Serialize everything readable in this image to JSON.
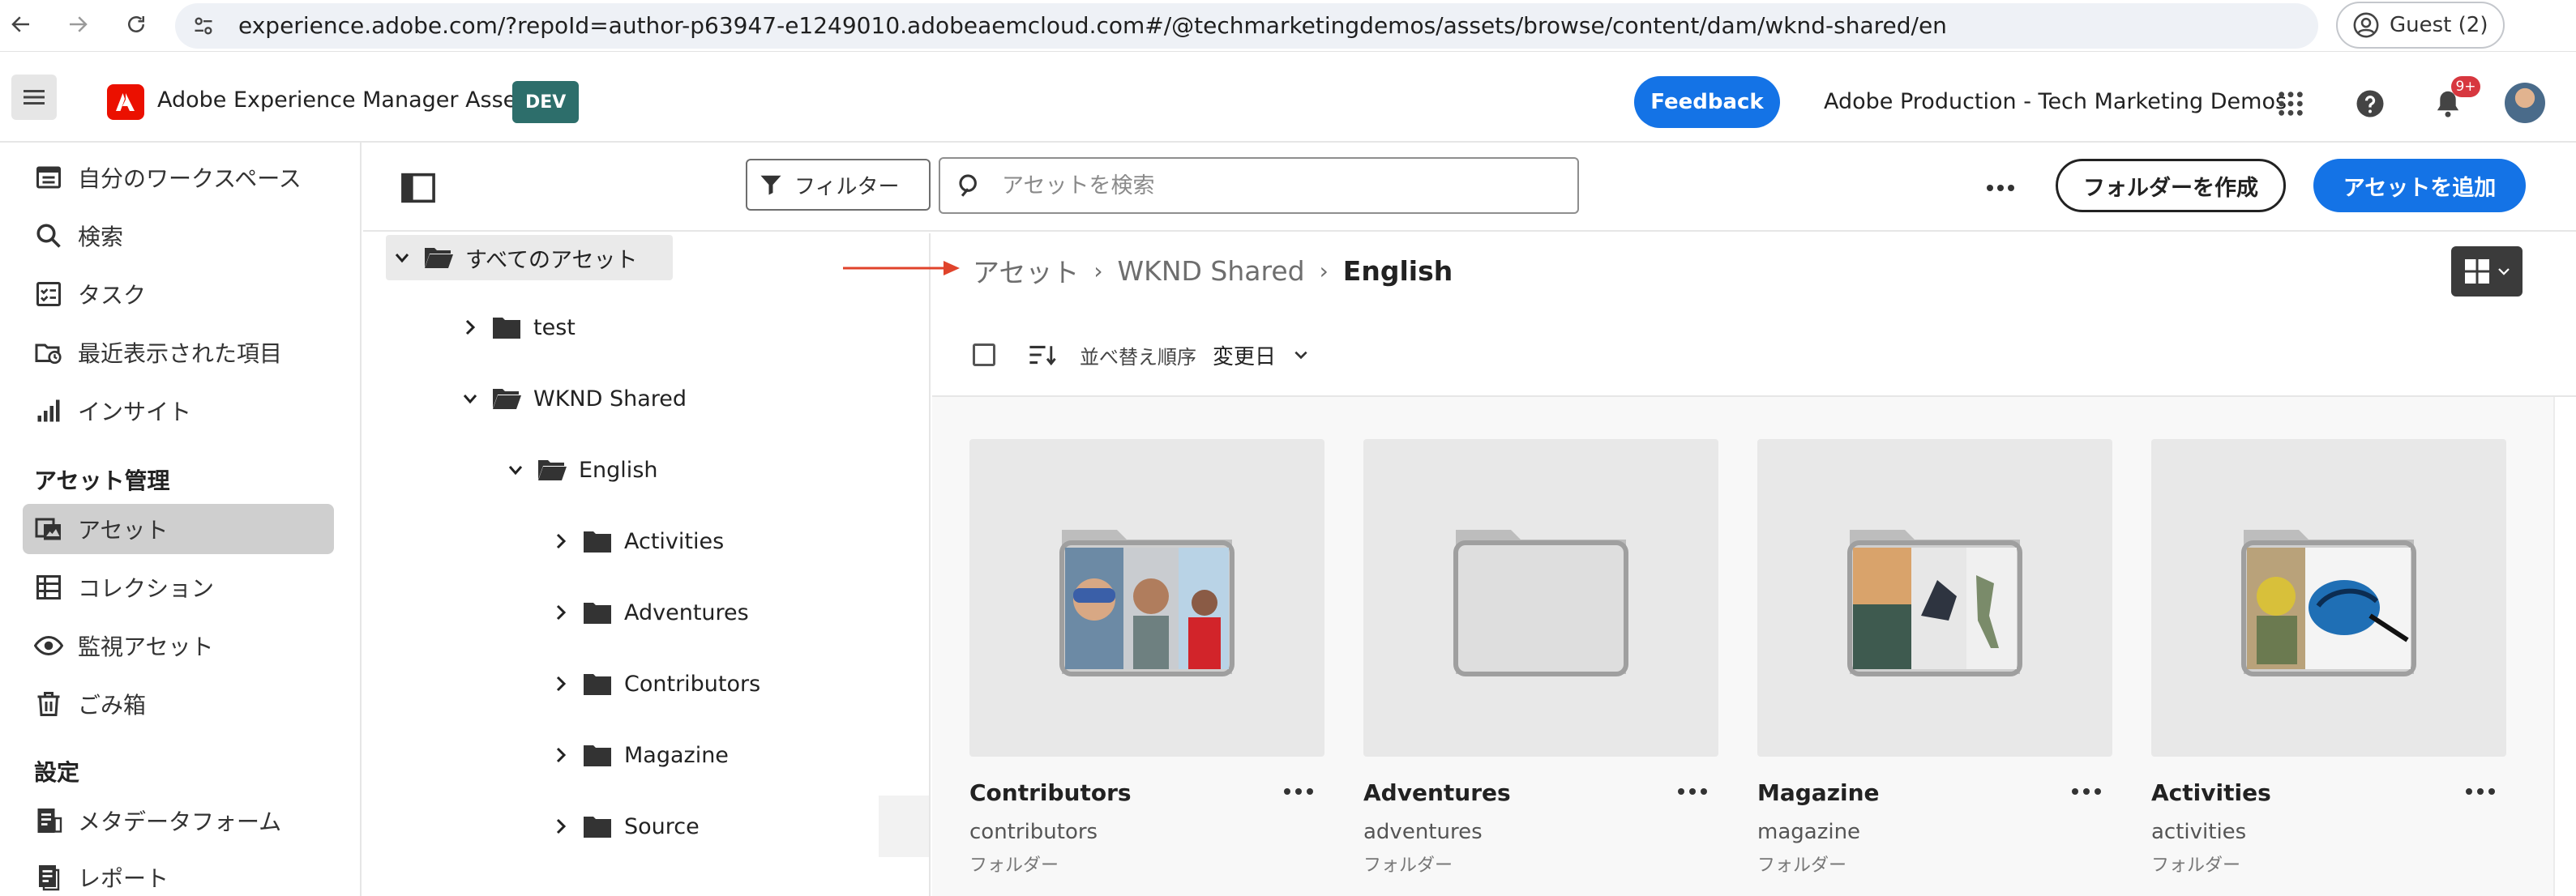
{
  "browser": {
    "url": "experience.adobe.com/?repoId=author-p63947-e1249010.adobeaemcloud.com#/@techmarketingdemos/assets/browse/content/dam/wknd-shared/en",
    "guest_label": "Guest (2)"
  },
  "header": {
    "app_name": "Adobe Experience Manager Assets",
    "env_badge": "DEV",
    "feedback_label": "Feedback",
    "org_name": "Adobe Production - Tech Marketing Demos",
    "notification_count": "9+"
  },
  "sidebar": {
    "items": [
      {
        "label": "自分のワークスペース",
        "icon": "workspace-icon"
      },
      {
        "label": "検索",
        "icon": "search-icon"
      },
      {
        "label": "タスク",
        "icon": "tasks-icon"
      },
      {
        "label": "最近表示された項目",
        "icon": "recent-icon"
      },
      {
        "label": "インサイト",
        "icon": "insights-icon"
      }
    ],
    "section_assets": "アセット管理",
    "asset_items": [
      {
        "label": "アセット",
        "icon": "assets-icon",
        "active": true
      },
      {
        "label": "コレクション",
        "icon": "collections-icon"
      },
      {
        "label": "監視アセット",
        "icon": "watch-icon"
      },
      {
        "label": "ごみ箱",
        "icon": "trash-icon"
      }
    ],
    "section_settings": "設定",
    "settings_items": [
      {
        "label": "メタデータフォーム",
        "icon": "metadata-form-icon"
      },
      {
        "label": "レポート",
        "icon": "reports-icon"
      }
    ]
  },
  "toolbar": {
    "filter_label": "フィルター",
    "search_placeholder": "アセットを検索",
    "create_folder_label": "フォルダーを作成",
    "add_asset_label": "アセットを追加"
  },
  "tree": {
    "root": "すべてのアセット",
    "nodes": [
      "test",
      "WKND Shared",
      "English",
      "Activities",
      "Adventures",
      "Contributors",
      "Magazine",
      "Source"
    ]
  },
  "breadcrumb": [
    "アセット",
    "WKND Shared",
    "English"
  ],
  "sort": {
    "label": "並べ替え順序",
    "value": "変更日"
  },
  "cards": [
    {
      "title": "Contributors",
      "name": "contributors",
      "type": "フォルダー"
    },
    {
      "title": "Adventures",
      "name": "adventures",
      "type": "フォルダー"
    },
    {
      "title": "Magazine",
      "name": "magazine",
      "type": "フォルダー"
    },
    {
      "title": "Activities",
      "name": "activities",
      "type": "フォルダー"
    }
  ],
  "colors": {
    "accent": "#1473e6",
    "adobe_red": "#eb1000",
    "dev_badge": "#2d6e6b",
    "annotation_arrow": "#e0432b"
  }
}
